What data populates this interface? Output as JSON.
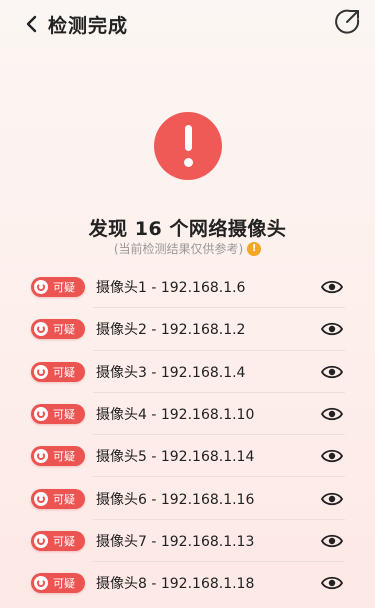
{
  "header": {
    "title": "检测完成"
  },
  "summary": {
    "headline": "发现 16 个网络摄像头",
    "note": "(当前检测结果仅供参考)",
    "warn_mark": "!"
  },
  "badge_label": "可疑",
  "cameras": [
    {
      "label": "摄像头1 - 192.168.1.6"
    },
    {
      "label": "摄像头2 - 192.168.1.2"
    },
    {
      "label": "摄像头3 - 192.168.1.4"
    },
    {
      "label": "摄像头4 - 192.168.1.10"
    },
    {
      "label": "摄像头5 - 192.168.1.14"
    },
    {
      "label": "摄像头6 - 192.168.1.16"
    },
    {
      "label": "摄像头7 - 192.168.1.13"
    },
    {
      "label": "摄像头8 - 192.168.1.18"
    }
  ],
  "colors": {
    "alert": "#ef5a57",
    "badge": "#ec5452",
    "warn": "#f5a623"
  },
  "icons": {
    "back": "chevron-left-icon",
    "share": "share-icon",
    "alert": "exclamation-icon",
    "view": "eye-icon"
  }
}
